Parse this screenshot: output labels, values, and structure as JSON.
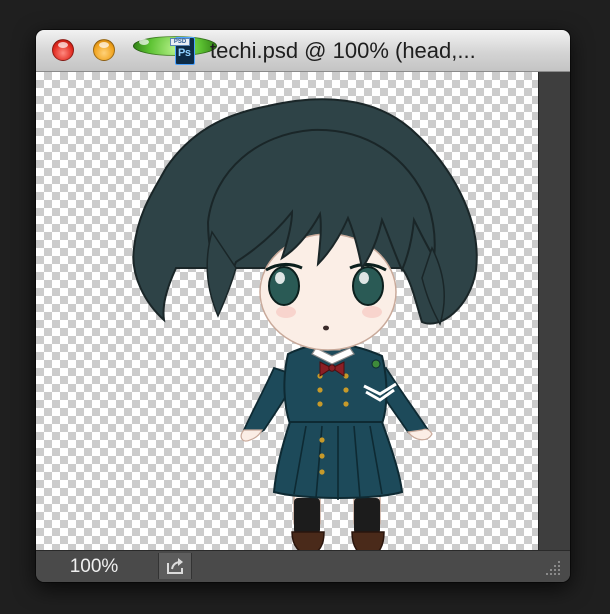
{
  "window": {
    "title": "techi.psd @ 100% (head,...",
    "file_icon": "photoshop-psd-file-icon",
    "file_icon_tag": "PSD",
    "file_icon_label": "Ps"
  },
  "traffic_lights": {
    "close": "close-icon",
    "minimize": "minimize-icon",
    "zoom": "zoom-icon"
  },
  "status_bar": {
    "zoom_level": "100%",
    "export_icon": "share-export-icon",
    "resize_grip_icon": "resize-grip-icon"
  },
  "canvas": {
    "background": "transparency-checkerboard",
    "content": "chibi character illustration"
  },
  "colors": {
    "hair": "#2e4347",
    "uniform": "#1d4a5a",
    "skin": "#fbeee6",
    "eyes": "#2a5a55",
    "ribbon": "#8a1f25"
  }
}
